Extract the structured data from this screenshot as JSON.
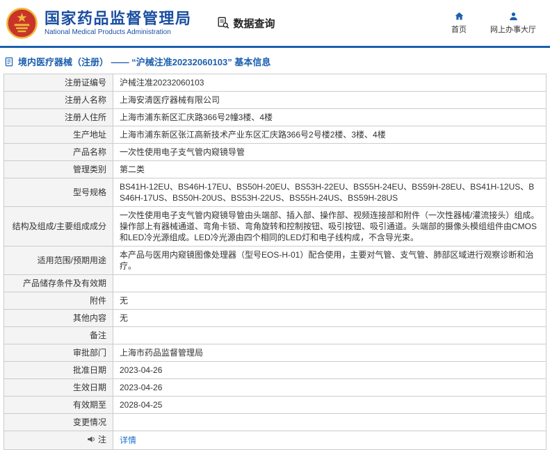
{
  "header": {
    "org_name_cn": "国家药品监督管理局",
    "org_name_en": "National Medical Products Administration",
    "section_title": "数据查询",
    "nav_home": "首页",
    "nav_hall": "网上办事大厅"
  },
  "breadcrumb": "境内医疗器械（注册） —— “沪械注准20232060103” 基本信息",
  "colors": {
    "brand_blue": "#1b4fa0",
    "line_blue": "#1b5fae",
    "link_blue": "#1e6fd0",
    "emblem_red": "#c8342a",
    "emblem_gold": "#f0b93c",
    "label_cell_bg": "#f4f4f4",
    "border_gray": "#cccccc"
  },
  "table": {
    "rows": [
      {
        "label": "注册证编号",
        "value": "沪械注准20232060103"
      },
      {
        "label": "注册人名称",
        "value": "上海安清医疗器械有限公司"
      },
      {
        "label": "注册人住所",
        "value": "上海市浦东新区汇庆路366号2幢3楼、4楼"
      },
      {
        "label": "生产地址",
        "value": "上海市浦东新区张江高新技术产业东区汇庆路366号2号楼2楼、3楼、4楼"
      },
      {
        "label": "产品名称",
        "value": "一次性使用电子支气管内窥镜导管"
      },
      {
        "label": "管理类别",
        "value": "第二类"
      },
      {
        "label": "型号规格",
        "value": "BS41H-12EU、BS46H-17EU、BS50H-20EU、BS53H-22EU、BS55H-24EU、BS59H-28EU、BS41H-12US、BS46H-17US、BS50H-20US、BS53H-22US、BS55H-24US、BS59H-28US"
      },
      {
        "label": "结构及组成/主要组成成分",
        "value": "一次性使用电子支气管内窥镜导管由头端部、插入部、操作部、视频连接部和附件（一次性器械/灌流接头）组成。操作部上有器械通道、弯角卡锁、弯角旋转和控制按钮、吸引按钮、吸引通道。头端部的摄像头模组组件由CMOS和LED冷光源组成。LED冷光源由四个相同的LED灯和电子线构成，不含导光束。"
      },
      {
        "label": "适用范围/预期用途",
        "value": "本产品与医用内窥镜图像处理器（型号EOS-H-01）配合使用，主要对气管、支气管、肺部区域进行观察诊断和治疗。"
      },
      {
        "label": "产品储存条件及有效期",
        "value": ""
      },
      {
        "label": "附件",
        "value": "无"
      },
      {
        "label": "其他内容",
        "value": "无"
      },
      {
        "label": "备注",
        "value": ""
      },
      {
        "label": "审批部门",
        "value": "上海市药品监督管理局"
      },
      {
        "label": "批准日期",
        "value": "2023-04-26"
      },
      {
        "label": "生效日期",
        "value": "2023-04-26"
      },
      {
        "label": "有效期至",
        "value": "2028-04-25"
      },
      {
        "label": "变更情况",
        "value": ""
      },
      {
        "label": "注",
        "icon": "megaphone-icon",
        "value": "详情",
        "link": true
      }
    ]
  }
}
